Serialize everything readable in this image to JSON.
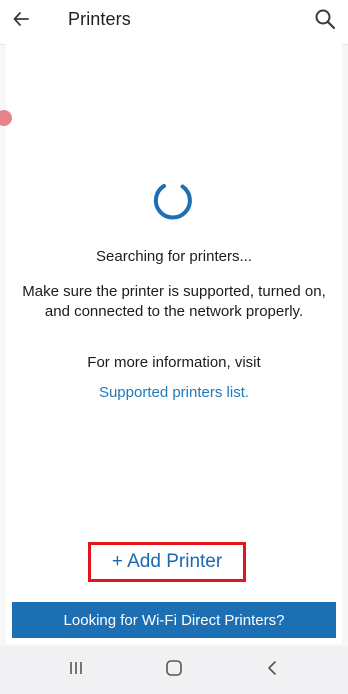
{
  "app_bar": {
    "title": "Printers",
    "back_icon": "arrow-left-icon",
    "search_icon": "search-icon"
  },
  "content": {
    "status": "Searching for printers...",
    "instructions": "Make sure the printer is supported, turned on, and connected to the network properly.",
    "more_info": "For more information, visit",
    "supported_link": "Supported printers list.",
    "add_printer": "+ Add Printer",
    "wifi_direct": "Looking for Wi-Fi Direct Printers?"
  },
  "nav_bar": {
    "recents_icon": "recent-apps-icon",
    "home_icon": "home-icon",
    "back_icon": "back-chevron-icon"
  },
  "colors": {
    "accent": "#1d6fb3",
    "link": "#1d7bbf",
    "highlight_border": "#e2141c"
  }
}
